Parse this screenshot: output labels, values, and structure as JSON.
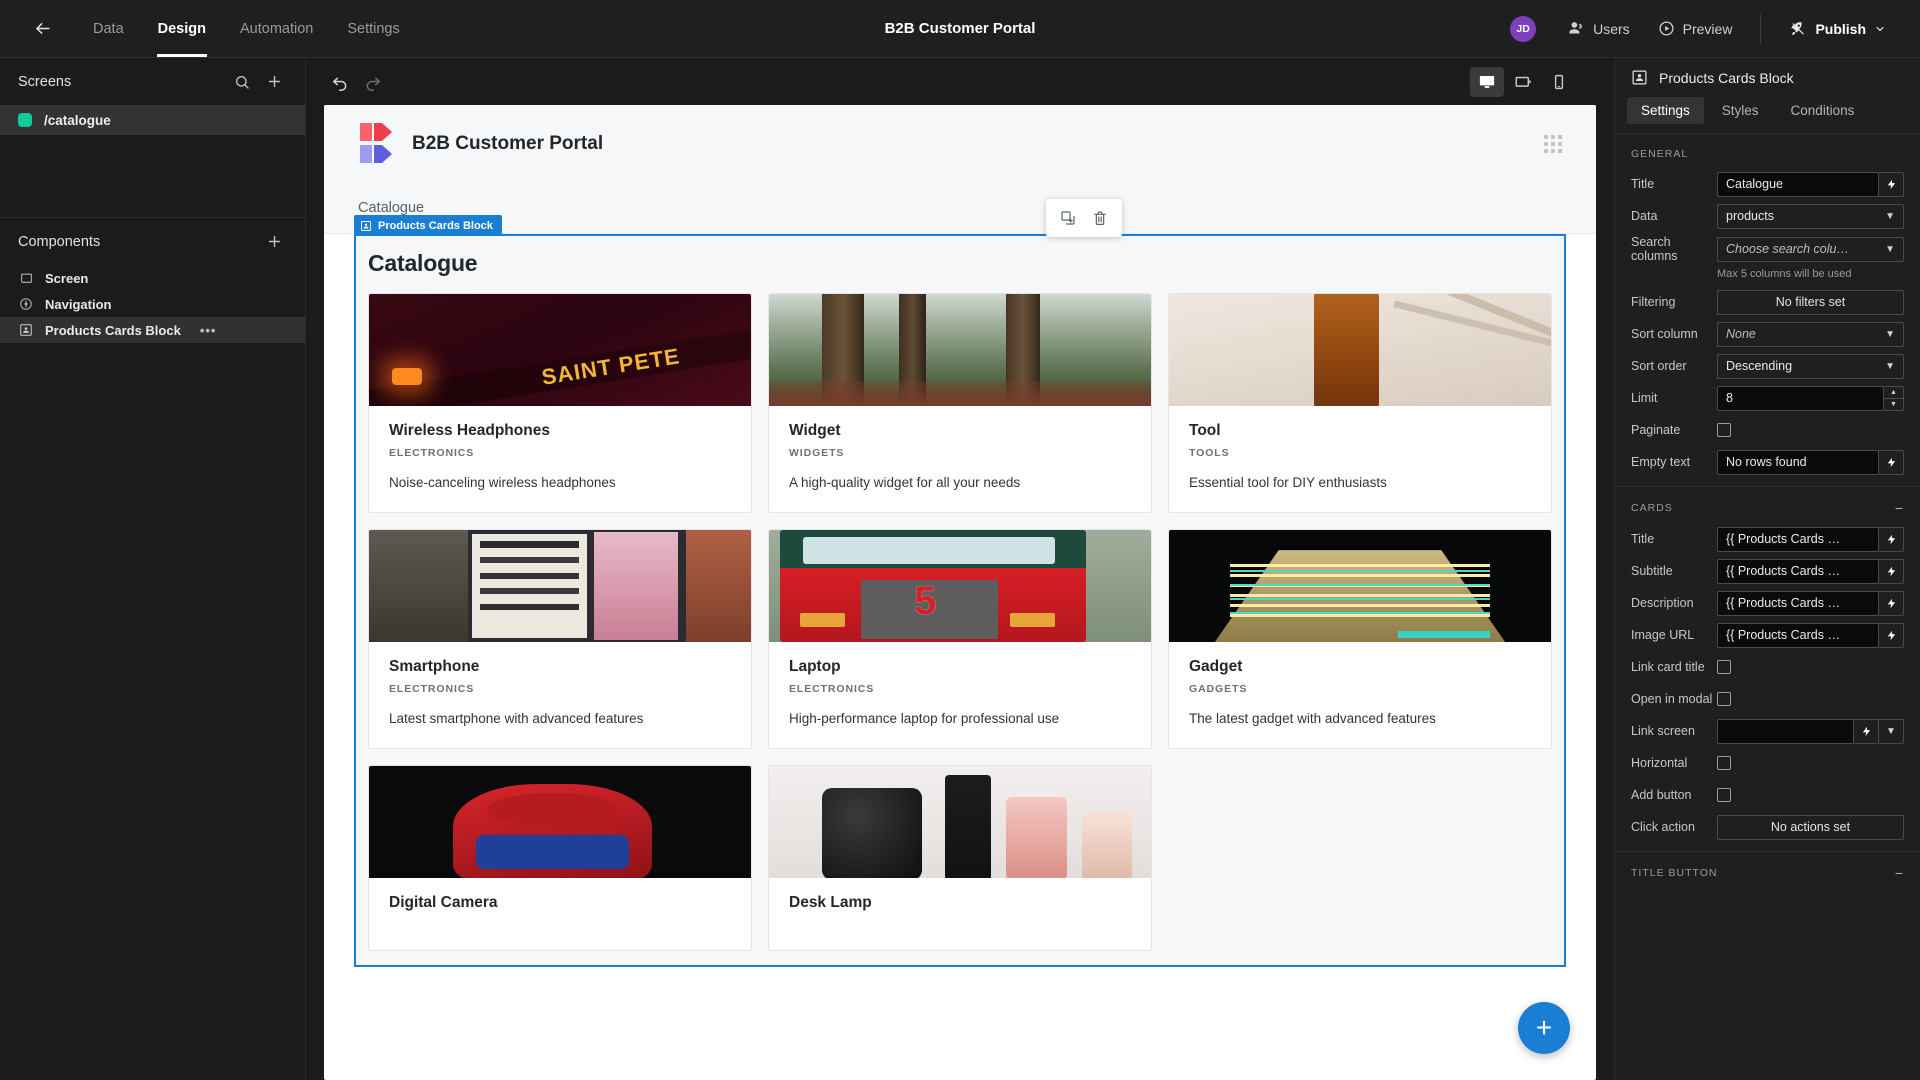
{
  "topbar": {
    "back_icon": "arrow-left-icon",
    "nav": [
      {
        "label": "Data",
        "active": false
      },
      {
        "label": "Design",
        "active": true
      },
      {
        "label": "Automation",
        "active": false
      },
      {
        "label": "Settings",
        "active": false
      }
    ],
    "title": "B2B Customer Portal",
    "avatar_initials": "JD",
    "avatar_color": "#7b3fbf",
    "users_label": "Users",
    "preview_label": "Preview",
    "publish_label": "Publish"
  },
  "left_panel": {
    "screens": {
      "heading": "Screens",
      "search_icon": "search-icon",
      "add_icon": "plus-icon",
      "items": [
        {
          "label": "/catalogue",
          "color": "#12c99b",
          "selected": true
        }
      ]
    },
    "components": {
      "heading": "Components",
      "add_icon": "plus-icon",
      "items": [
        {
          "label": "Screen",
          "icon": "screen-icon",
          "selected": false,
          "more": false
        },
        {
          "label": "Navigation",
          "icon": "navigation-icon",
          "selected": false,
          "more": false
        },
        {
          "label": "Products Cards Block",
          "icon": "cards-block-icon",
          "selected": true,
          "more": true,
          "more_label": "•••"
        }
      ]
    }
  },
  "canvas_toolbar": {
    "undo_icon": "undo-icon",
    "redo_icon": "redo-icon",
    "devices": [
      {
        "name": "desktop-icon",
        "active": true
      },
      {
        "name": "tablet-icon",
        "active": false
      },
      {
        "name": "mobile-icon",
        "active": false
      }
    ]
  },
  "canvas": {
    "brand_name": "B2B Customer Portal",
    "drag_handle_icon": "drag-handle-icon",
    "nav_label": "Catalogue",
    "hover_toolbar": [
      {
        "name": "duplicate-icon"
      },
      {
        "name": "trash-icon"
      }
    ],
    "block_badge": "Products Cards Block",
    "block_badge_icon": "cards-block-icon",
    "block_title": "Catalogue",
    "fab_label": "+",
    "cards": [
      {
        "title": "Wireless Headphones",
        "subtitle": "ELECTRONICS",
        "description": "Noise-canceling wireless headphones",
        "image": "saint-peter-neon-sign"
      },
      {
        "title": "Widget",
        "subtitle": "WIDGETS",
        "description": "A high-quality widget for all your needs",
        "image": "forest-trees"
      },
      {
        "title": "Tool",
        "subtitle": "TOOLS",
        "description": "Essential tool for DIY enthusiasts",
        "image": "amber-bottle"
      },
      {
        "title": "Smartphone",
        "subtitle": "ELECTRONICS",
        "description": "Latest smartphone with advanced features",
        "image": "concert-posters-wall"
      },
      {
        "title": "Laptop",
        "subtitle": "ELECTRONICS",
        "description": "High-performance laptop for professional use",
        "image": "red-fire-truck"
      },
      {
        "title": "Gadget",
        "subtitle": "GADGETS",
        "description": "The latest gadget with advanced features",
        "image": "illuminated-building"
      },
      {
        "title": "Digital Camera",
        "subtitle": "",
        "description": "",
        "image": "spiderman-figure"
      },
      {
        "title": "Desk Lamp",
        "subtitle": "",
        "description": "",
        "image": "perfume-bottles"
      }
    ]
  },
  "right_panel": {
    "header_title": "Products Cards Block",
    "header_icon": "cards-block-icon",
    "tabs": [
      {
        "label": "Settings",
        "active": true
      },
      {
        "label": "Styles",
        "active": false
      },
      {
        "label": "Conditions",
        "active": false
      }
    ],
    "general": {
      "section_label": "GENERAL",
      "title_label": "Title",
      "title_value": "Catalogue",
      "data_label": "Data",
      "data_value": "products",
      "search_columns_label": "Search columns",
      "search_columns_placeholder": "Choose search colu…",
      "search_columns_hint": "Max 5 columns will be used",
      "filtering_label": "Filtering",
      "filtering_value": "No filters set",
      "sort_column_label": "Sort column",
      "sort_column_value": "None",
      "sort_order_label": "Sort order",
      "sort_order_value": "Descending",
      "limit_label": "Limit",
      "limit_value": "8",
      "paginate_label": "Paginate",
      "paginate_checked": false,
      "empty_text_label": "Empty text",
      "empty_text_value": "No rows found"
    },
    "cards": {
      "section_label": "CARDS",
      "collapse_icon": "minus-icon",
      "title_label": "Title",
      "title_value": "{{ Products Cards …",
      "subtitle_label": "Subtitle",
      "subtitle_value": "{{ Products Cards …",
      "description_label": "Description",
      "description_value": "{{ Products Cards …",
      "image_url_label": "Image URL",
      "image_url_value": "{{ Products Cards …",
      "link_card_title_label": "Link card title",
      "link_card_title_checked": false,
      "open_in_modal_label": "Open in modal",
      "open_in_modal_checked": false,
      "link_screen_label": "Link screen",
      "link_screen_value": "",
      "horizontal_label": "Horizontal",
      "horizontal_checked": false,
      "add_button_label": "Add button",
      "add_button_checked": false,
      "click_action_label": "Click action",
      "click_action_value": "No actions set"
    },
    "title_button": {
      "section_label": "TITLE BUTTON",
      "collapse_icon": "minus-icon"
    }
  },
  "colors": {
    "accent_blue": "#1a7fd4",
    "avatar_purple": "#7b3fbf",
    "screen_dot_green": "#12c99b",
    "panel_bg": "#1f1f1f",
    "canvas_bg": "#f6f7f8"
  }
}
